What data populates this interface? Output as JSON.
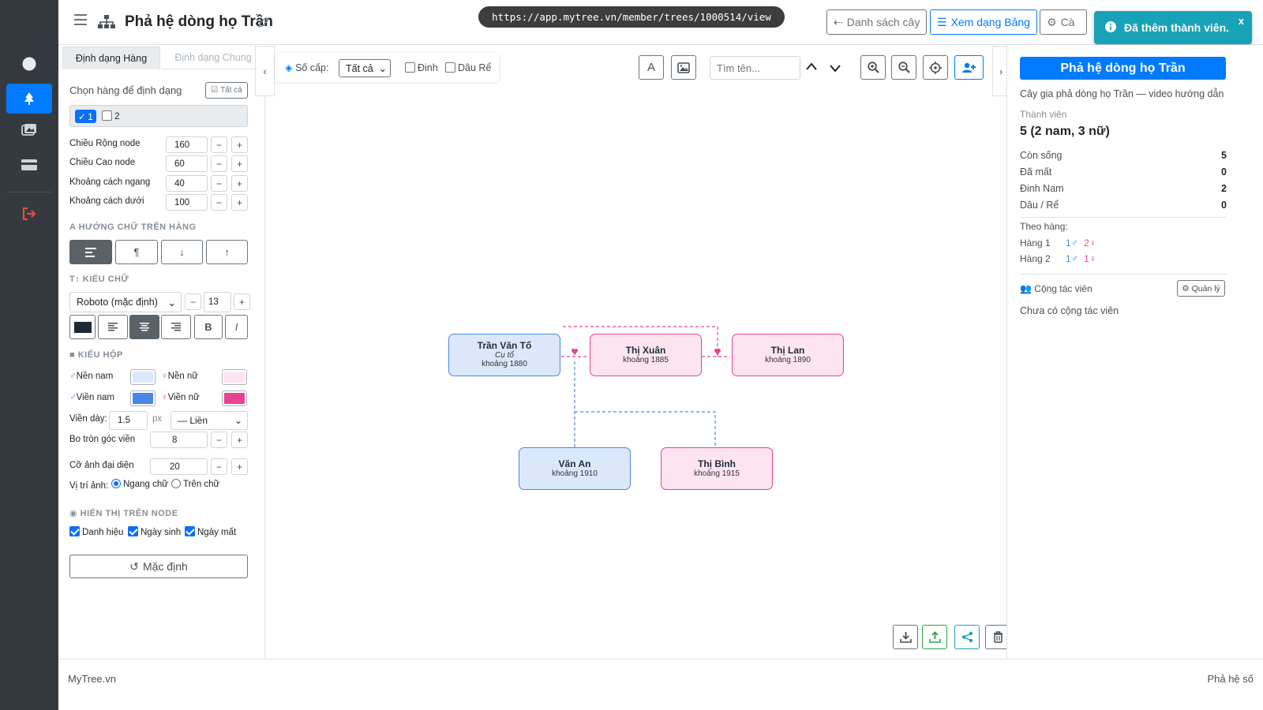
{
  "header": {
    "title": "Phả hệ dòng họ Trần",
    "url": "https://app.mytree.vn/member/trees/1000514/view",
    "btn_list": "Danh sách cây",
    "btn_table": "Xem dạng Bảng",
    "btn_settings": "Cà"
  },
  "toast": {
    "message": "Đã thêm thành viên.",
    "close": "x"
  },
  "left_panel": {
    "tab_row": "Định dạng Hàng",
    "tab_general": "Định dạng Chung",
    "choose_row": "Chọn hàng để định dạng",
    "select_all": "Tất cả",
    "row_options": [
      {
        "label": "1",
        "checked": true
      },
      {
        "label": "2",
        "checked": false
      }
    ],
    "fields": [
      {
        "label": "Chiều Rộng node",
        "value": "160"
      },
      {
        "label": "Chiều Cao node",
        "value": "60"
      },
      {
        "label": "Khoảng cách ngang",
        "value": "40"
      },
      {
        "label": "Khoảng cách dưới",
        "value": "100"
      }
    ],
    "sec_direction": "HƯỚNG CHỮ TRÊN HÀNG",
    "sec_font": "KIỂU CHỮ",
    "font_name": "Roboto (mặc định)",
    "font_size": "13",
    "bold": "B",
    "italic": "I",
    "sec_box": "KIỂU HỘP",
    "bg_male": "Nền nam",
    "bg_female": "Nền nữ",
    "border_male": "Viền nam",
    "border_female": "Viền nữ",
    "border_width_label": "Viền dày:",
    "border_width": "1.5",
    "border_unit": "px",
    "border_style": "— Liền",
    "radius_label": "Bo tròn góc viền",
    "radius": "8",
    "avatar_label": "Cỡ ảnh đại diện",
    "avatar": "20",
    "img_pos_label": "Vị trí ảnh:",
    "img_pos_h": "Ngang chữ",
    "img_pos_top": "Trên chữ",
    "sec_display": "HIỂN THỊ TRÊN NODE",
    "show_title": "Danh hiệu",
    "show_birth": "Ngày sinh",
    "show_death": "Ngày mất",
    "reset": "Mặc định",
    "colors": {
      "bg_male": "#dbe8fc",
      "bg_female": "#fde4f0",
      "border_male": "#4a86e8",
      "border_female": "#e84393"
    }
  },
  "toolbar": {
    "levels_label": "Số cấp:",
    "levels_value": "Tất cả",
    "filter_dinh": "Đinh",
    "filter_dau": "Dâu Rể",
    "search_placeholder": "Tìm tên..."
  },
  "tree": {
    "nodes": [
      {
        "name": "Trần Văn Tố",
        "title": "Cụ tổ",
        "year": "khoảng 1880",
        "gender": "m"
      },
      {
        "name": "Thị Xuân",
        "title": "",
        "year": "khoảng 1885",
        "gender": "f"
      },
      {
        "name": "Thị Lan",
        "title": "",
        "year": "khoảng 1890",
        "gender": "f"
      },
      {
        "name": "Văn An",
        "title": "",
        "year": "khoảng 1910",
        "gender": "m"
      },
      {
        "name": "Thị Bình",
        "title": "",
        "year": "khoảng 1915",
        "gender": "f"
      }
    ]
  },
  "right_panel": {
    "title": "Phả hệ dòng họ Trần",
    "description": "Cây gia phả dòng họ Trần — video hướng dẫn",
    "members_label": "Thành viên",
    "members_value": "5 (2 nam, 3 nữ)",
    "stats": [
      {
        "label": "Còn sống",
        "value": "5"
      },
      {
        "label": "Đã mất",
        "value": "0"
      },
      {
        "label": "Đinh Nam",
        "value": "2"
      },
      {
        "label": "Dâu / Rể",
        "value": "0"
      }
    ],
    "by_row_label": "Theo hàng:",
    "rows": [
      {
        "label": "Hàng 1",
        "male": "1♂",
        "female": "2♀"
      },
      {
        "label": "Hàng 2",
        "male": "1♂",
        "female": "1♀"
      }
    ],
    "collab_label": "Cộng tác viên",
    "manage": "Quản lý",
    "no_collab": "Chưa có cộng tác viên"
  },
  "footer": {
    "brand": "MyTree.vn",
    "right": "Phả hệ số"
  }
}
